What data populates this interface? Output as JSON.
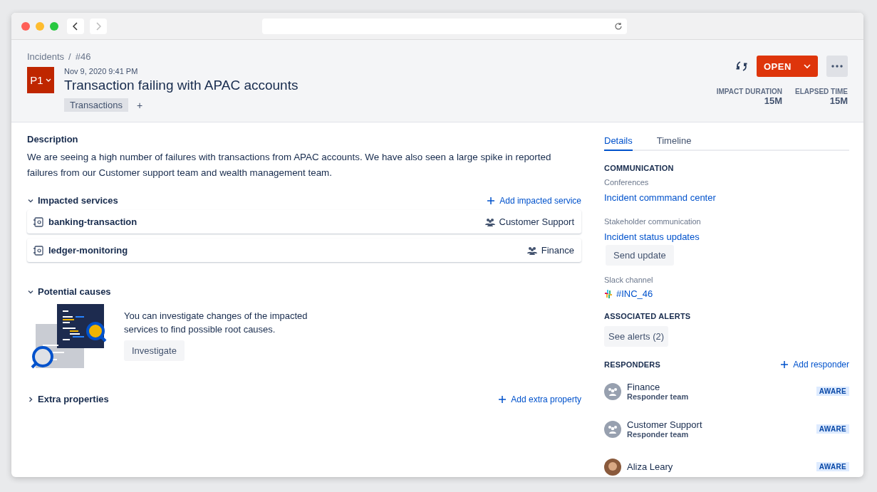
{
  "breadcrumbs": [
    "Incidents",
    "#46"
  ],
  "breadcrumb_separator": "/",
  "priority": "P1",
  "created": "Nov 9, 2020 9:41 PM",
  "title": "Transaction failing with APAC accounts",
  "tags": [
    "Transactions"
  ],
  "add_tag": "+",
  "status": "OPEN",
  "metrics": [
    {
      "label": "IMPACT DURATION",
      "value": "15M"
    },
    {
      "label": "ELAPSED TIME",
      "value": "15M"
    }
  ],
  "description": {
    "heading": "Description",
    "text": "We are seeing a high number of failures with transactions from APAC accounts. We have also seen a large spike in reported failures from our Customer support team and wealth management team."
  },
  "impacted_services": {
    "heading": "Impacted services",
    "expanded": true,
    "action": "Add impacted service",
    "rows": [
      {
        "name": "banking-transaction",
        "team": "Customer Support"
      },
      {
        "name": "ledger-monitoring",
        "team": "Finance"
      }
    ]
  },
  "potential_causes": {
    "heading": "Potential causes",
    "expanded": true,
    "text": "You can investigate changes of the impacted services to find possible root causes.",
    "button": "Investigate"
  },
  "extra_properties": {
    "heading": "Extra properties",
    "expanded": false,
    "action": "Add extra property"
  },
  "tabs": [
    {
      "label": "Details",
      "selected": true
    },
    {
      "label": "Timeline",
      "selected": false
    }
  ],
  "communication": {
    "heading": "COMMUNICATION",
    "conferences_label": "Conferences",
    "conference_link": "Incident commmand center",
    "stakeholder_label": "Stakeholder communication",
    "stakeholder_link": "Incident status updates",
    "send_button": "Send update",
    "slack_label": "Slack channel",
    "slack_channel": "#INC_46"
  },
  "alerts": {
    "heading": "ASSOCIATED ALERTS",
    "button": "See alerts (2)"
  },
  "responders": {
    "heading": "RESPONDERS",
    "action": "Add responder",
    "items": [
      {
        "kind": "team",
        "name": "Finance",
        "role": "Responder team",
        "status": "AWARE"
      },
      {
        "kind": "team",
        "name": "Customer Support",
        "role": "Responder team",
        "status": "AWARE"
      },
      {
        "kind": "person",
        "name": "Aliza Leary",
        "status": "AWARE"
      }
    ]
  }
}
